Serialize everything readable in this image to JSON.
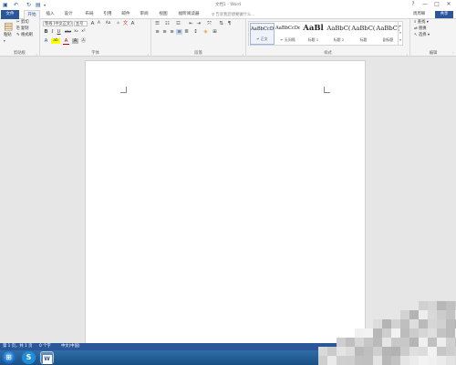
{
  "titlebar": {
    "title": "文档1 - Word",
    "quick_access": [
      "save-icon",
      "undo-icon",
      "redo-icon",
      "touch-mode-icon"
    ],
    "controls": [
      "?",
      "—",
      "□",
      "✕"
    ]
  },
  "tabs": {
    "file": "文件",
    "items": [
      "开始",
      "插入",
      "设计",
      "布局",
      "引用",
      "邮件",
      "审阅",
      "视图",
      "福昕阅读器"
    ],
    "active": "开始",
    "tell_me": "告诉我您想要做什么...",
    "user": "周周嘛",
    "share": "共享"
  },
  "ribbon": {
    "clipboard": {
      "paste": "粘贴",
      "cut": "剪切",
      "copy": "复制",
      "format_painter": "格式刷",
      "label": "剪贴板"
    },
    "font": {
      "font_name": "等线 (中文正文)",
      "font_size": "五号",
      "label": "字体",
      "row2": [
        "B",
        "I",
        "U",
        "abc",
        "x₂",
        "x²"
      ],
      "row3": [
        "A",
        "ab",
        "A",
        "A",
        "Ⓐ"
      ]
    },
    "paragraph": {
      "label": "段落"
    },
    "styles": {
      "label": "样式",
      "items": [
        {
          "preview": "AaBbCcDd",
          "name": "↵ 正文",
          "selected": true
        },
        {
          "preview": "AaBbCcDd",
          "name": "↵ 无间隔",
          "selected": false
        },
        {
          "preview": "AaBl",
          "name": "标题 1",
          "selected": false
        },
        {
          "preview": "AaBbC(",
          "name": "标题 2",
          "selected": false
        },
        {
          "preview": "AaBbC(",
          "name": "标题",
          "selected": false
        },
        {
          "preview": "AaBbC(",
          "name": "副标题",
          "selected": false
        }
      ]
    },
    "editing": {
      "find": "查找",
      "replace": "替换",
      "select": "选择",
      "label": "编辑"
    }
  },
  "statusbar": {
    "page": "第 1 页，共 1 页",
    "words": "0 个字",
    "language": "中文(中国)"
  },
  "colors": {
    "brand": "#2b579a",
    "taskbar": "#1b4f86"
  }
}
